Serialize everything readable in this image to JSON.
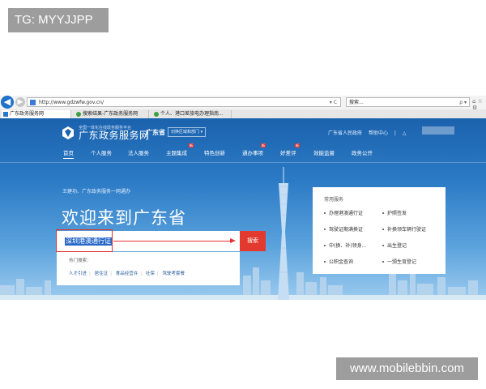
{
  "watermarks": {
    "top_left": "TG: MYYJJPP",
    "bottom_right": "www.mobilebbin.com"
  },
  "browser": {
    "url": "http://www.gdzwfw.gov.cn/",
    "url_controls": "▾ C",
    "search_placeholder": "搜索...",
    "search_controls": "ρ ▾",
    "tabs": [
      {
        "label": "广东政务服务网",
        "active": true
      },
      {
        "label": "搜索结果-广东政务服务网",
        "active": false
      },
      {
        "label": "个人、港口差旅电办理指南...",
        "active": false
      }
    ],
    "nav_icons": "⌂ ☆ ⚙"
  },
  "site": {
    "logo_tag": "全国一体化在线政务服务平台",
    "logo_title": "广东政务服务网",
    "region": "广东省",
    "region_select": "切换区域和部门 ▾",
    "top_links": [
      "广东省人民政府",
      "帮助中心",
      "|",
      "△"
    ],
    "nav": [
      {
        "label": "首页",
        "active": true
      },
      {
        "label": "个人服务",
        "active": false
      },
      {
        "label": "法人服务",
        "active": false
      },
      {
        "label": "主题集成",
        "active": false,
        "badge": "新"
      },
      {
        "label": "特色创新",
        "active": false
      },
      {
        "label": "通办事项",
        "active": false,
        "badge": "新"
      },
      {
        "label": "好差评",
        "active": false,
        "badge": "新"
      },
      {
        "label": "效能监督",
        "active": false
      },
      {
        "label": "政务公开",
        "active": false
      }
    ],
    "welcome_sub": "王建功、广东政务服务一网通办",
    "welcome_title": "欢迎来到广东省",
    "search_value": "深圳港澳通行证",
    "search_button": "搜索",
    "hot_label": "热门搜索：",
    "hot_links": [
      "人才引进",
      "居住证",
      "食品经营许",
      "社保",
      "驾驶考套餐"
    ],
    "services_title": "常用服务",
    "services": [
      [
        "办理港澳通行证",
        "护照签发"
      ],
      [
        "驾驶证期满换证",
        "补换领车辆行驶证"
      ],
      [
        "中(换、补)领身…",
        "出生登记"
      ],
      [
        "公积金查询",
        "一颁生育登记"
      ]
    ]
  },
  "colors": {
    "site_blue": "#1b62ad",
    "search_red": "#e23a2e",
    "annotation_red": "#e03030",
    "ie_blue": "#1f72c8"
  }
}
